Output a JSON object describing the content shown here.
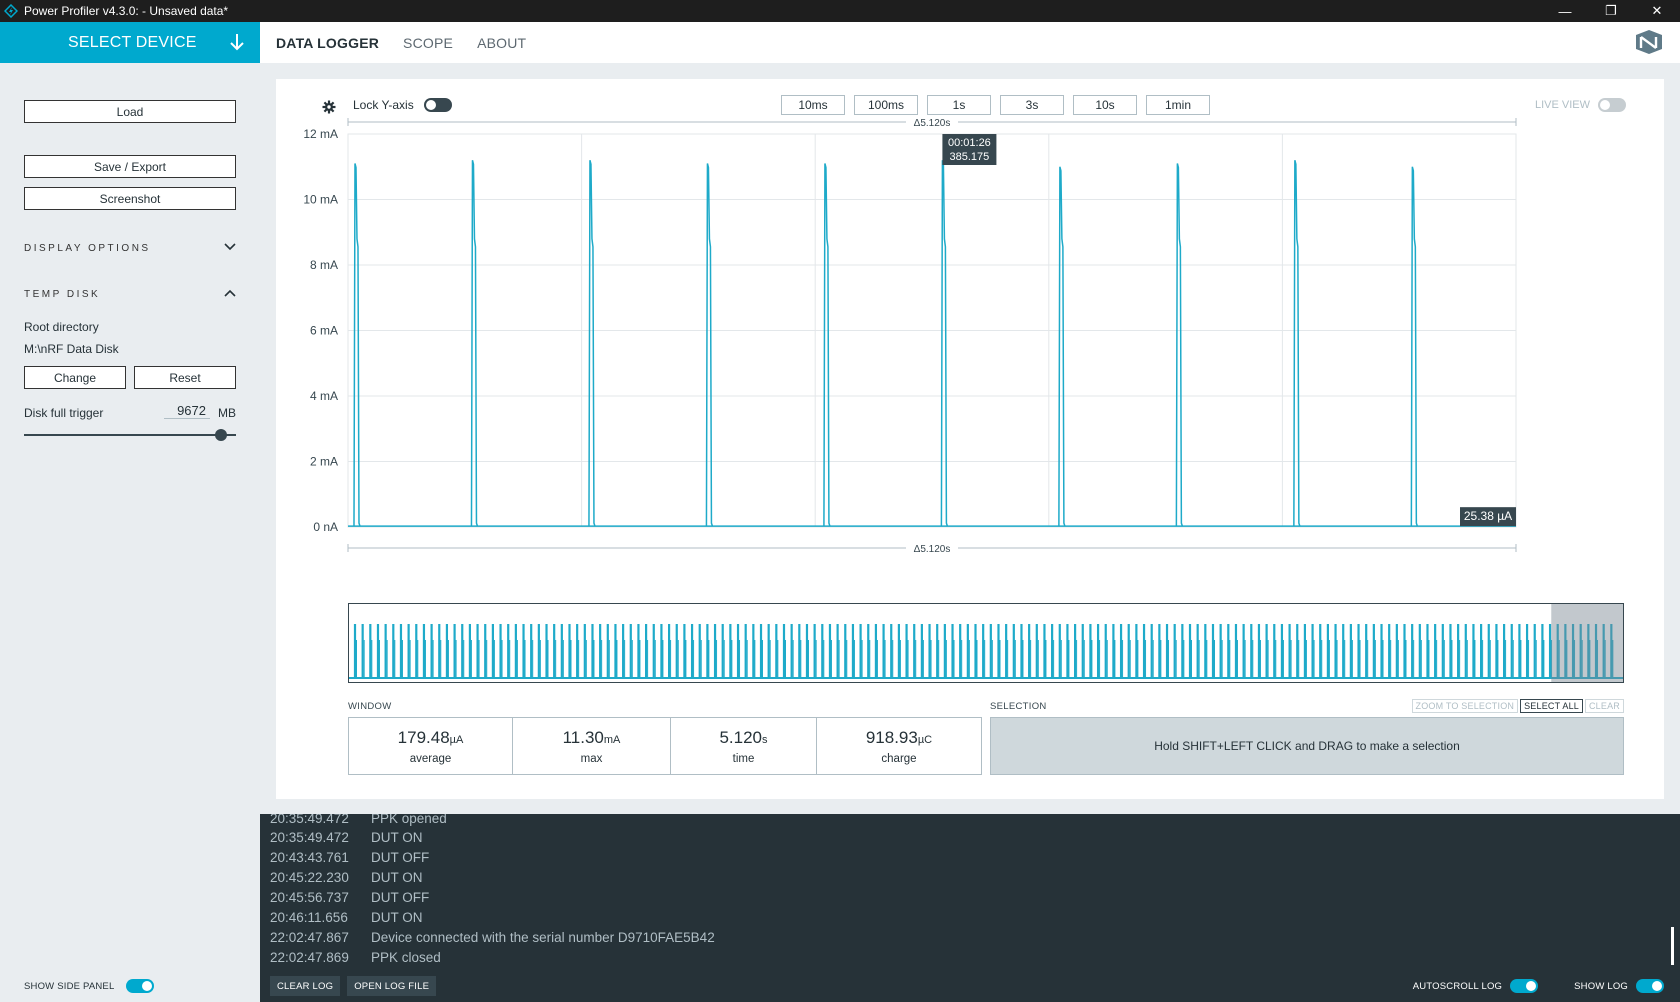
{
  "window": {
    "title": "Power Profiler v4.3.0:  - Unsaved data*",
    "minimize_glyph": "—",
    "maximize_glyph": "❐",
    "close_glyph": "✕"
  },
  "select_device": {
    "label": "SELECT DEVICE",
    "icon": "arrow-down-icon"
  },
  "nav": {
    "tabs": [
      {
        "label": "DATA LOGGER",
        "active": true
      },
      {
        "label": "SCOPE",
        "active": false
      },
      {
        "label": "ABOUT",
        "active": false
      }
    ]
  },
  "sidebar": {
    "load_label": "Load",
    "save_export_label": "Save / Export",
    "screenshot_label": "Screenshot",
    "display_options_label": "DISPLAY OPTIONS",
    "temp_disk_label": "TEMP DISK",
    "root_directory_label": "Root directory",
    "root_directory_value": "M:\\nRF Data Disk",
    "change_label": "Change",
    "reset_label": "Reset",
    "disk_full_trigger_label": "Disk full trigger",
    "disk_full_trigger_value": "9672",
    "disk_full_trigger_unit": "MB",
    "disk_slider_level": 0.93,
    "show_side_panel_label": "SHOW SIDE PANEL",
    "show_side_panel_on": true
  },
  "chart_toolbar": {
    "lock_y_axis_label": "Lock Y-axis",
    "lock_y_axis_on": false,
    "time_buttons": [
      "10ms",
      "100ms",
      "1s",
      "3s",
      "10s",
      "1min"
    ],
    "live_view_label": "LIVE VIEW",
    "live_view_on": false
  },
  "chart_data": {
    "type": "line",
    "ylabel": "",
    "xlabel": "",
    "y_unit": "mA",
    "yticks": [
      "12 mA",
      "10 mA",
      "8 mA",
      "6 mA",
      "4 mA",
      "2 mA",
      "0 nA"
    ],
    "ylim": [
      0,
      12
    ],
    "window_duration_label": "Δ5.120s",
    "window_duration_s": 5.12,
    "spike_times_s": [
      0.035,
      0.55,
      1.065,
      1.58,
      2.095,
      2.61,
      3.125,
      3.64,
      4.155,
      4.67
    ],
    "spike_peak_mA": [
      11.1,
      11.2,
      11.2,
      11.1,
      11.1,
      11.2,
      11.0,
      11.1,
      11.2,
      11.0
    ],
    "spike_shoulder_mA": 8.8,
    "baseline_uA": 25.38,
    "cursor_label_time": "00:01:26",
    "cursor_label_value": "385.175",
    "current_value_label": "25.38 µA",
    "grid": true,
    "minimap_pulse_count": 165,
    "minimap_viewport_fraction": 0.057
  },
  "stats": {
    "window_label": "WINDOW",
    "selection_label": "SELECTION",
    "items": [
      {
        "value": "179.48",
        "unit": "µA",
        "name": "average"
      },
      {
        "value": "11.30",
        "unit": "mA",
        "name": "max"
      },
      {
        "value": "5.120",
        "unit": "s",
        "name": "time"
      },
      {
        "value": "918.93",
        "unit": "µC",
        "name": "charge"
      }
    ],
    "selection_hint": "Hold SHIFT+LEFT CLICK and DRAG to make a selection",
    "zoom_to_selection_label": "ZOOM TO SELECTION",
    "select_all_label": "SELECT ALL",
    "clear_label": "CLEAR"
  },
  "log": {
    "entries": [
      {
        "time": "20:35:49.472",
        "message": "PPK opened"
      },
      {
        "time": "20:35:49.472",
        "message": "DUT ON"
      },
      {
        "time": "20:43:43.761",
        "message": "DUT OFF"
      },
      {
        "time": "20:45:22.230",
        "message": "DUT ON"
      },
      {
        "time": "20:45:56.737",
        "message": "DUT OFF"
      },
      {
        "time": "20:46:11.656",
        "message": "DUT ON"
      },
      {
        "time": "22:02:47.867",
        "message": "Device connected with the serial number D9710FAE5B42"
      },
      {
        "time": "22:02:47.869",
        "message": "PPK closed"
      }
    ],
    "clear_log_label": "CLEAR LOG",
    "open_log_file_label": "OPEN LOG FILE",
    "autoscroll_log_label": "AUTOSCROLL LOG",
    "autoscroll_on": true,
    "show_log_label": "SHOW LOG",
    "show_log_on": true
  },
  "colors": {
    "accent": "#00a9ce",
    "trace": "#1eaac9",
    "dark": "#263238",
    "panel_bg": "#e9edf0"
  }
}
